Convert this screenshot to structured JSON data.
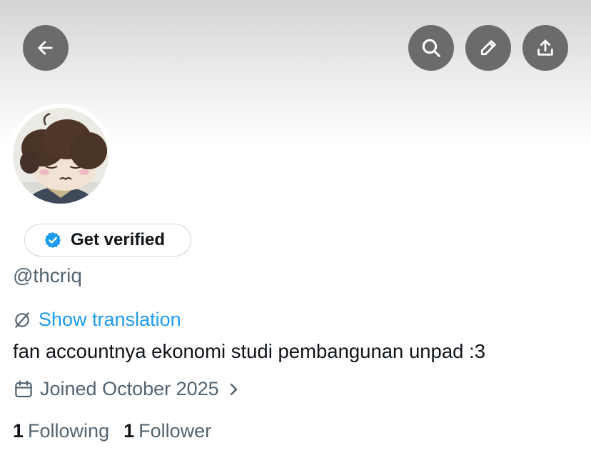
{
  "header": {
    "back_icon": "arrow-left-icon",
    "search_icon": "search-icon",
    "edit_icon": "pencil-icon",
    "share_icon": "share-upload-icon"
  },
  "colors": {
    "button_bg": "#6b6b6b",
    "link": "#1d9bf0",
    "muted": "#536471",
    "text": "#0f1419",
    "border": "#cfd9de"
  },
  "profile": {
    "get_verified_label": "Get verified",
    "handle": "@thcriq",
    "show_translation_label": "Show translation",
    "bio": "fan accountnya ekonomi studi pembangunan unpad :3",
    "joined": "Joined October 2025",
    "following_count": "1",
    "following_label": "Following",
    "followers_count": "1",
    "followers_label": "Follower"
  }
}
